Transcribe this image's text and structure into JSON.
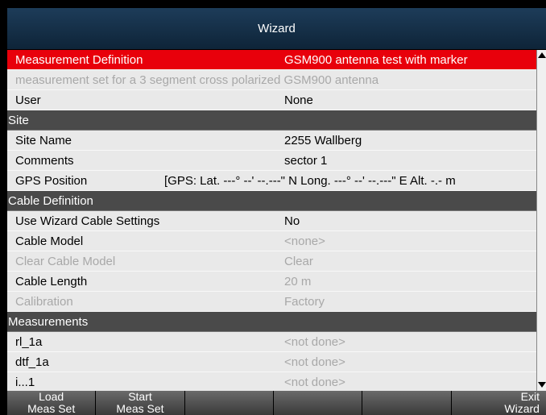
{
  "window": {
    "title": "Wizard"
  },
  "rows": [
    {
      "type": "selected",
      "label": "Measurement Definition",
      "value": "GSM900 antenna test with marker"
    },
    {
      "type": "subtitle",
      "label": "measurement set for a 3 segment cross polarized GSM900 antenna",
      "value": ""
    },
    {
      "type": "item",
      "label": "User",
      "value": "None"
    },
    {
      "type": "header",
      "label": "Site",
      "value": ""
    },
    {
      "type": "item",
      "label": "Site Name",
      "value": "2255 Wallberg"
    },
    {
      "type": "item",
      "label": "Comments",
      "value": "sector 1"
    },
    {
      "type": "gps",
      "label": "GPS Position",
      "value": "[GPS: Lat.  ---° --' --.---\" N  Long.  ---° --' --.---\" E  Alt. -.- m"
    },
    {
      "type": "header",
      "label": "Cable Definition",
      "value": ""
    },
    {
      "type": "item",
      "label": "Use Wizard Cable Settings",
      "value": "No"
    },
    {
      "type": "item",
      "label": "Cable Model",
      "value": "<none>",
      "value_dim": true
    },
    {
      "type": "disabled",
      "label": "Clear Cable Model",
      "value": "Clear"
    },
    {
      "type": "item",
      "label": "Cable Length",
      "value": "20 m",
      "value_dim": true
    },
    {
      "type": "disabled",
      "label": "Calibration",
      "value": "Factory"
    },
    {
      "type": "header",
      "label": "Measurements",
      "value": ""
    },
    {
      "type": "item",
      "label": "rl_1a",
      "value": "<not done>",
      "value_dim": true
    },
    {
      "type": "item",
      "label": "dtf_1a",
      "value": "<not done>",
      "value_dim": true
    },
    {
      "type": "item",
      "label": "i...1",
      "value": "<not done>",
      "value_dim": true
    }
  ],
  "softkeys": [
    {
      "label": "Load\nMeas Set",
      "name": "load-meas-set-button"
    },
    {
      "label": "Start\nMeas Set",
      "name": "start-meas-set-button"
    },
    {
      "label": "",
      "name": "softkey-3"
    },
    {
      "label": "",
      "name": "softkey-4"
    },
    {
      "label": "",
      "name": "softkey-5"
    },
    {
      "label": "Exit\nWizard",
      "name": "exit-wizard-button"
    }
  ],
  "colors": {
    "selected": "#e8000b",
    "header": "#4a4a4a",
    "title_bar": "#153048"
  }
}
